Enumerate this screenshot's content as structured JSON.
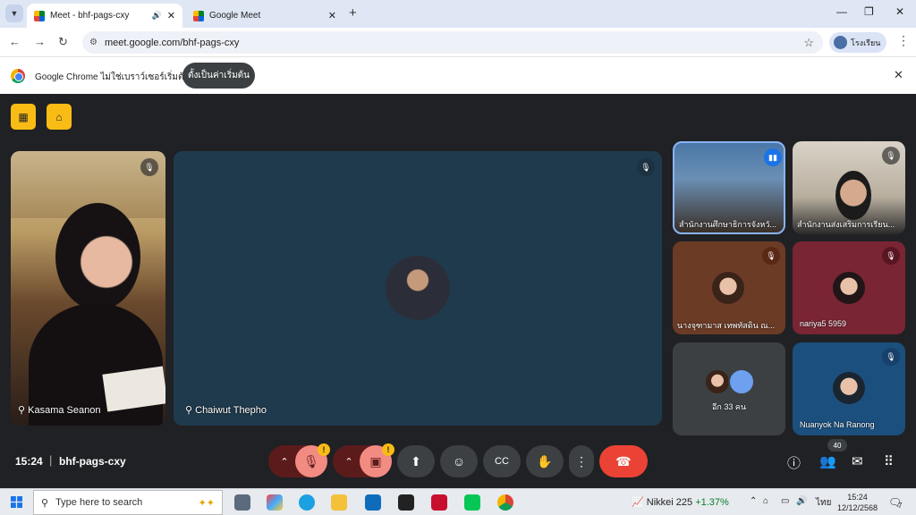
{
  "browser": {
    "tabs": [
      {
        "title": "Meet - bhf-pags-cxy",
        "active": true
      },
      {
        "title": "Google Meet",
        "active": false
      }
    ],
    "url": "meet.google.com/bhf-pags-cxy",
    "profile_name": "โรงเรียน",
    "info_text": "Google Chrome ไม่ใช่เบราว์เซอร์เริ่มต้น",
    "info_button": "ตั้งเป็นค่าเริ่มต้น"
  },
  "meet": {
    "participants_main": [
      {
        "name": "Kasama Seanon"
      },
      {
        "name": "Chaiwut Thepho"
      }
    ],
    "participants_side": [
      {
        "name": "สำนักงานศึกษาธิการจังหวั..."
      },
      {
        "name": "สำนักงานส่งเสริมการเรียน..."
      },
      {
        "name": "นางจุฑามาส เทพทัสดิน ณ..."
      },
      {
        "name": "nariya5 5959"
      },
      {
        "name": "อีก 33 คน"
      },
      {
        "name": "Nuanyok Na Ranong"
      }
    ],
    "time": "15:24",
    "meeting_code": "bhf-pags-cxy",
    "participant_count": "40",
    "accent_red": "#ea4335",
    "accent_yellow": "#f9bc15"
  },
  "taskbar": {
    "search_placeholder": "Type here to search",
    "nikkei_label": "Nikkei 225",
    "nikkei_change": "+1.37%",
    "lang": "ไทย",
    "clock_time": "15:24",
    "clock_date": "12/12/2568",
    "notif_count": "7"
  }
}
